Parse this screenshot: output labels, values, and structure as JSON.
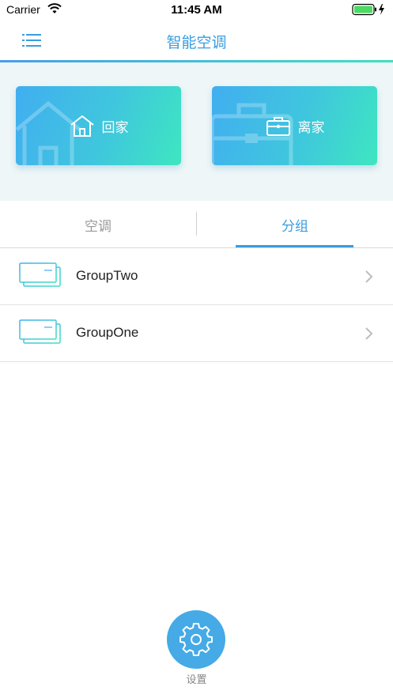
{
  "status_bar": {
    "carrier": "Carrier",
    "time": "11:45 AM"
  },
  "nav": {
    "title": "智能空调",
    "menu_icon": "menu-icon"
  },
  "scenes": [
    {
      "label": "回家",
      "icon": "home-icon"
    },
    {
      "label": "离家",
      "icon": "briefcase-icon"
    }
  ],
  "tabs": {
    "left": "空调",
    "right": "分组",
    "active": "right"
  },
  "groups": [
    {
      "name": "GroupTwo",
      "icon": "air-conditioner-icon"
    },
    {
      "name": "GroupOne",
      "icon": "air-conditioner-icon"
    }
  ],
  "bottom": {
    "settings_label": "设置",
    "icon": "gear-icon"
  },
  "colors": {
    "accent": "#3a9de0",
    "gradient_start": "#41aef0",
    "gradient_end": "#3ee6c0",
    "settings_button": "#45aae6"
  }
}
